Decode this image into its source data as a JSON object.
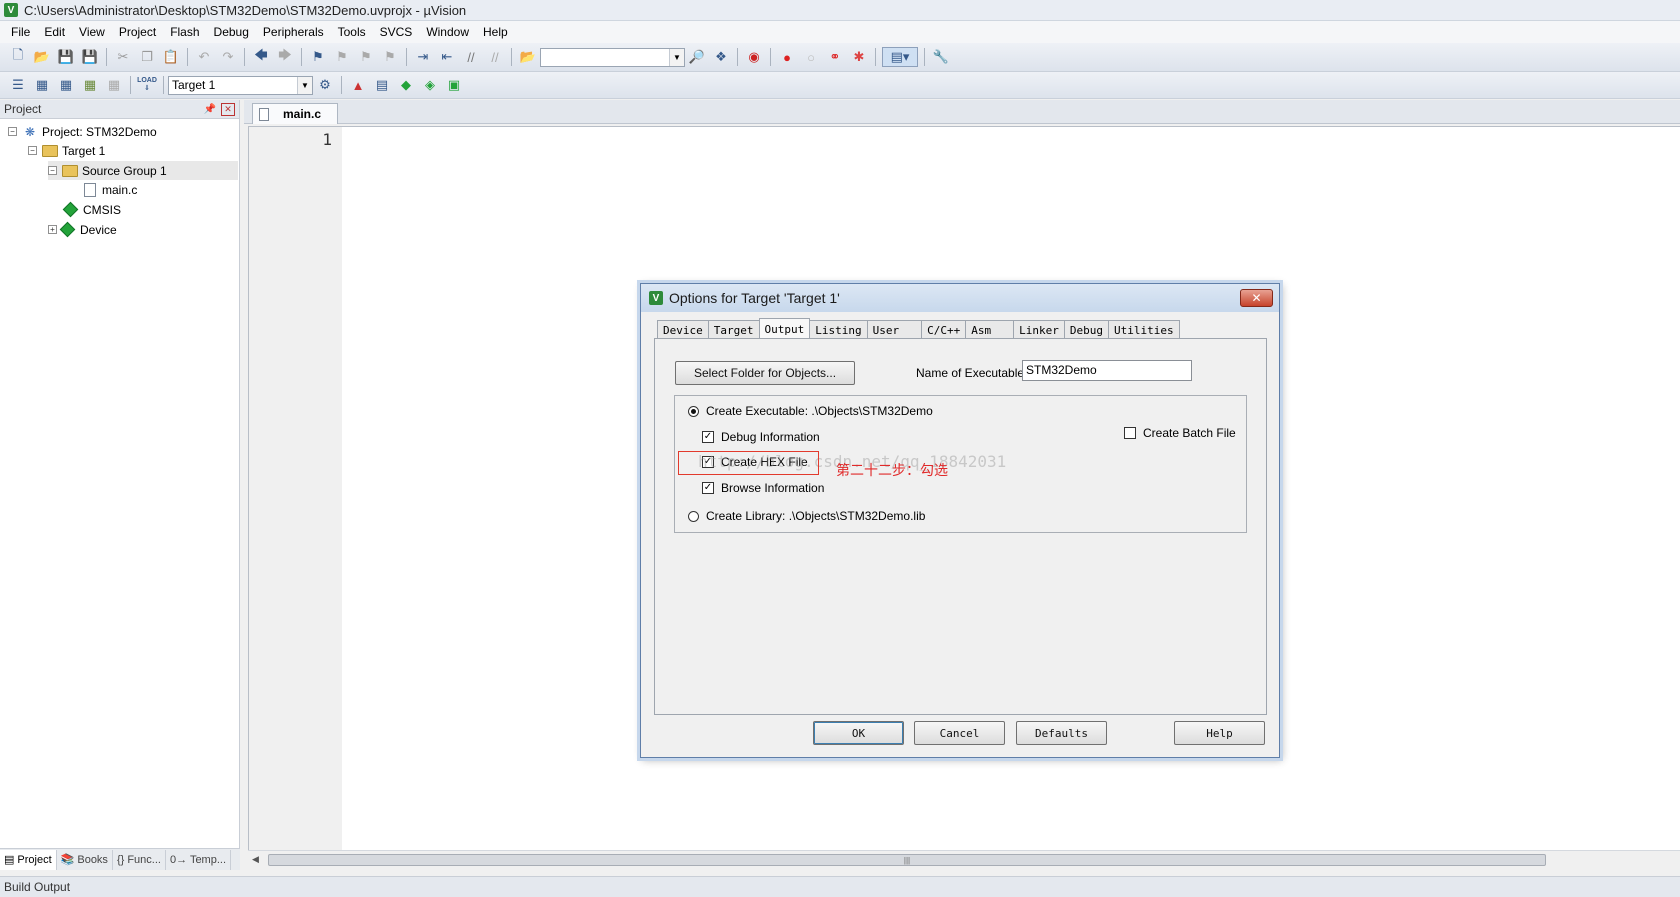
{
  "window": {
    "title": "C:\\Users\\Administrator\\Desktop\\STM32Demo\\STM32Demo.uvprojx - µVision"
  },
  "menu": [
    "File",
    "Edit",
    "View",
    "Project",
    "Flash",
    "Debug",
    "Peripherals",
    "Tools",
    "SVCS",
    "Window",
    "Help"
  ],
  "toolbar": {
    "target_combo": "Target 1",
    "load_label": "LOAD"
  },
  "project_panel": {
    "header": "Project",
    "tree": {
      "project": "Project: STM32Demo",
      "target": "Target 1",
      "group": "Source Group 1",
      "file": "main.c",
      "cmsis": "CMSIS",
      "device": "Device"
    },
    "tabs": [
      "Project",
      "Books",
      "{} Func...",
      "0→ Temp..."
    ]
  },
  "editor": {
    "tab": "main.c",
    "line_number": "1"
  },
  "status": {
    "build_output": "Build Output"
  },
  "dialog": {
    "title": "Options for Target 'Target 1'",
    "tabs": [
      "Device",
      "Target",
      "Output",
      "Listing",
      "User",
      "C/C++",
      "Asm",
      "Linker",
      "Debug",
      "Utilities"
    ],
    "active_tab": "Output",
    "select_folder_button": "Select Folder for Objects...",
    "name_label": "Name of Executable:",
    "name_value": "STM32Demo",
    "create_executable": "Create Executable:  .\\Objects\\STM32Demo",
    "debug_info": "Debug Information",
    "create_hex": "Create HEX File",
    "browse_info": "Browse Information",
    "create_library": "Create Library:  .\\Objects\\STM32Demo.lib",
    "create_batch": "Create Batch File",
    "annotation": "第二十二步：勾选",
    "watermark": "http://blog.csdn.net/qq_18842031",
    "buttons": {
      "ok": "OK",
      "cancel": "Cancel",
      "defaults": "Defaults",
      "help": "Help"
    },
    "checkbox_states": {
      "debug_info": true,
      "create_hex": true,
      "browse_info": true,
      "create_batch": false
    },
    "radio_selected": "create_executable"
  }
}
